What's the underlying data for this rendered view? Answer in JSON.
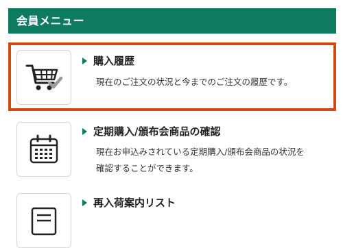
{
  "header": {
    "title": "会員メニュー"
  },
  "menu": [
    {
      "title": "購入履歴",
      "desc": [
        "現在のご注文の状況と今までのご注文の履歴です。"
      ],
      "icon": "cart-check-icon"
    },
    {
      "title": "定期購入/頒布会商品の確認",
      "desc": [
        "現在お申込みされている定期購入/頒布会商品の状況を",
        "確認することができます。"
      ],
      "icon": "calendar-icon"
    },
    {
      "title": "再入荷案内リスト",
      "desc": [],
      "icon": "list-icon"
    }
  ],
  "colors": {
    "header_bg": "#0e7a5f",
    "highlight_border": "#cd4a12",
    "arrow": "#0e7a5f"
  }
}
